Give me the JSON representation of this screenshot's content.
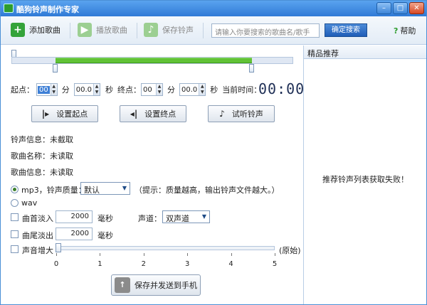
{
  "window": {
    "title": "酷狗铃声制作专家"
  },
  "toolbar": {
    "add_song": "添加歌曲",
    "play_song": "播放歌曲",
    "save_ringtone": "保存铃声",
    "search_placeholder": "请输入你要搜索的歌曲名/歌手",
    "search_button": "确定搜索",
    "help": "帮助"
  },
  "editor": {
    "start_label": "起点：",
    "start_min": "00",
    "min_unit": "分",
    "start_sec": "00.0",
    "sec_unit": "秒",
    "end_label": "终点：",
    "end_min": "00",
    "end_sec": "00.0",
    "current_time_label": "当前时间：",
    "current_time": "00:00",
    "set_start": "设置起点",
    "set_end": "设置终点",
    "preview": "试听铃声",
    "ringtone_info": "铃声信息：未截取",
    "song_name": "歌曲名称：未读取",
    "song_info": "歌曲信息：未读取",
    "mp3_label": "mp3，铃声质量：",
    "quality": "默认",
    "quality_tip": "（提示：质量越高，输出铃声文件越大。）",
    "wav_label": "wav",
    "fade_in_label": "曲首淡入",
    "fade_in_value": "2000",
    "ms_unit": "毫秒",
    "channel_label": "声道：",
    "channel_value": "双声道",
    "fade_out_label": "曲尾淡出",
    "fade_out_value": "2000",
    "volume_label": "声音增大",
    "volume_original": "(原始)",
    "volume_ticks": [
      "0",
      "1",
      "2",
      "3",
      "4",
      "5"
    ],
    "volume_level": 0,
    "save_send": "保存并发送到手机"
  },
  "sidebar": {
    "header": "精品推荐",
    "message": "推荐铃声列表获取失败！"
  },
  "colors": {
    "titlebar": "#2f7ad6",
    "range": "#61c236",
    "accent": "#1f5db7"
  }
}
